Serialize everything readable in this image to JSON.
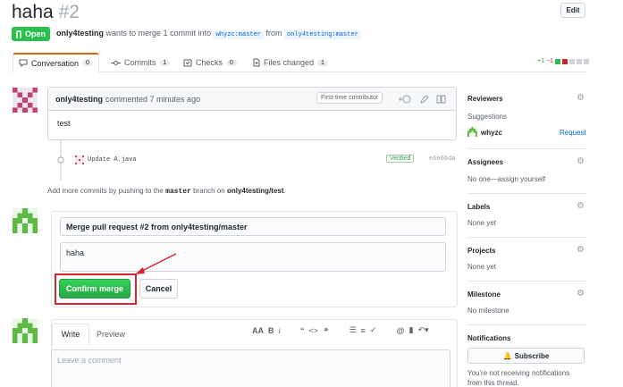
{
  "header": {
    "title": "haha",
    "number": "#2",
    "edit_label": "Edit",
    "state_label": "Open",
    "author": "only4testing",
    "merge_text": "wants to merge 1 commit into",
    "base_branch": "whyzc:master",
    "from_text": "from",
    "head_branch": "only4testing:master"
  },
  "tabs": [
    {
      "label": "Conversation",
      "count": "0"
    },
    {
      "label": "Commits",
      "count": "1"
    },
    {
      "label": "Checks",
      "count": "0"
    },
    {
      "label": "Files changed",
      "count": "1"
    }
  ],
  "diffstat": {
    "additions": "+1",
    "deletions": "−1"
  },
  "comment": {
    "author": "only4testing",
    "meta": "commented 7 minutes ago",
    "badge": "First-time contributor",
    "body": "test"
  },
  "commit": {
    "message": "Update A.java",
    "verified": "Verified",
    "sha": "e6e66da"
  },
  "hint": {
    "prefix": "Add more commits by pushing to the",
    "branch": "master",
    "middle": "branch on",
    "repo": "only4testing/test",
    "suffix": "."
  },
  "merge": {
    "title_value": "Merge pull request #2 from only4testing/master",
    "message_value": "haha",
    "confirm_label": "Confirm merge",
    "cancel_label": "Cancel"
  },
  "new_comment": {
    "write_tab": "Write",
    "preview_tab": "Preview",
    "placeholder": "Leave a comment"
  },
  "sidebar": {
    "reviewers_title": "Reviewers",
    "suggestions_label": "Suggestions",
    "reviewer_name": "whyzc",
    "request_label": "Request",
    "assignees_title": "Assignees",
    "assignees_text": "No one—assign yourself",
    "labels_title": "Labels",
    "labels_text": "None yet",
    "projects_title": "Projects",
    "projects_text": "None yet",
    "milestone_title": "Milestone",
    "milestone_text": "No milestone",
    "notifications_title": "Notifications",
    "subscribe_label": "Subscribe",
    "notifications_text_1": "You're not receiving notifications",
    "notifications_text_2": "from this thread."
  },
  "colors": {
    "open_green": "#2cbe4e",
    "merge_green": "#28a745",
    "annotation_red": "#d7262f",
    "link_blue": "#0366d6"
  }
}
